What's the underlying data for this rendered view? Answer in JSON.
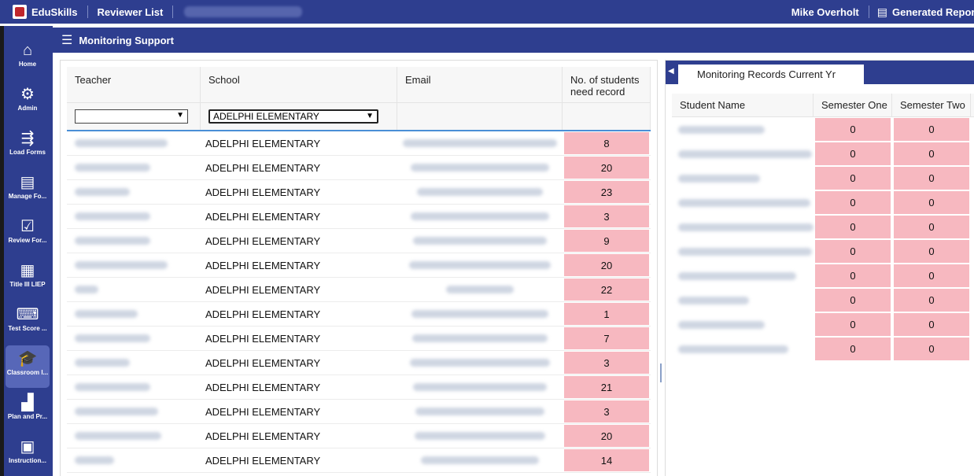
{
  "topbar": {
    "brand": "EduSkills",
    "reviewer_list": "Reviewer List",
    "user_name": "Mike Overholt",
    "generated_reports": "Generated Reports"
  },
  "nav": [
    {
      "label": "Home",
      "icon": "home-icon"
    },
    {
      "label": "Admin",
      "icon": "user-gear-icon"
    },
    {
      "label": "Load Forms",
      "icon": "load-forms-icon"
    },
    {
      "label": "Manage Fo...",
      "icon": "document-icon"
    },
    {
      "label": "Review For...",
      "icon": "clipboard-check-icon"
    },
    {
      "label": "Title III LIEP",
      "icon": "presentation-icon"
    },
    {
      "label": "Test Score ...",
      "icon": "keyboard-icon"
    },
    {
      "label": "Classroom I...",
      "icon": "student-cap-icon"
    },
    {
      "label": "Plan and Pr...",
      "icon": "bar-chart-icon"
    },
    {
      "label": "Instruction...",
      "icon": "layout-icon"
    }
  ],
  "page_title": "Monitoring Support",
  "left_table": {
    "headers": {
      "teacher": "Teacher",
      "school": "School",
      "email": "Email",
      "num": "No. of students need record"
    },
    "filter": {
      "teacher": "",
      "school": "ADELPHI ELEMENTARY"
    },
    "rows": [
      {
        "school": "ADELPHI ELEMENTARY",
        "count": "8"
      },
      {
        "school": "ADELPHI ELEMENTARY",
        "count": "20"
      },
      {
        "school": "ADELPHI ELEMENTARY",
        "count": "23"
      },
      {
        "school": "ADELPHI ELEMENTARY",
        "count": "3"
      },
      {
        "school": "ADELPHI ELEMENTARY",
        "count": "9"
      },
      {
        "school": "ADELPHI ELEMENTARY",
        "count": "20"
      },
      {
        "school": "ADELPHI ELEMENTARY",
        "count": "22"
      },
      {
        "school": "ADELPHI ELEMENTARY",
        "count": "1"
      },
      {
        "school": "ADELPHI ELEMENTARY",
        "count": "7"
      },
      {
        "school": "ADELPHI ELEMENTARY",
        "count": "3"
      },
      {
        "school": "ADELPHI ELEMENTARY",
        "count": "21"
      },
      {
        "school": "ADELPHI ELEMENTARY",
        "count": "3"
      },
      {
        "school": "ADELPHI ELEMENTARY",
        "count": "20"
      },
      {
        "school": "ADELPHI ELEMENTARY",
        "count": "14"
      }
    ]
  },
  "right_panel": {
    "tab": "Monitoring Records Current Yr",
    "headers": {
      "name": "Student Name",
      "s1": "Semester One",
      "s2": "Semester Two"
    },
    "rows": [
      {
        "s1": "0",
        "s2": "0"
      },
      {
        "s1": "0",
        "s2": "0"
      },
      {
        "s1": "0",
        "s2": "0"
      },
      {
        "s1": "0",
        "s2": "0"
      },
      {
        "s1": "0",
        "s2": "0"
      },
      {
        "s1": "0",
        "s2": "0"
      },
      {
        "s1": "0",
        "s2": "0"
      },
      {
        "s1": "0",
        "s2": "0"
      },
      {
        "s1": "0",
        "s2": "0"
      },
      {
        "s1": "0",
        "s2": "0"
      }
    ]
  },
  "colors": {
    "primary": "#2e3e8f",
    "highlight": "#f7b8c0",
    "active_nav": "#5767b8"
  }
}
